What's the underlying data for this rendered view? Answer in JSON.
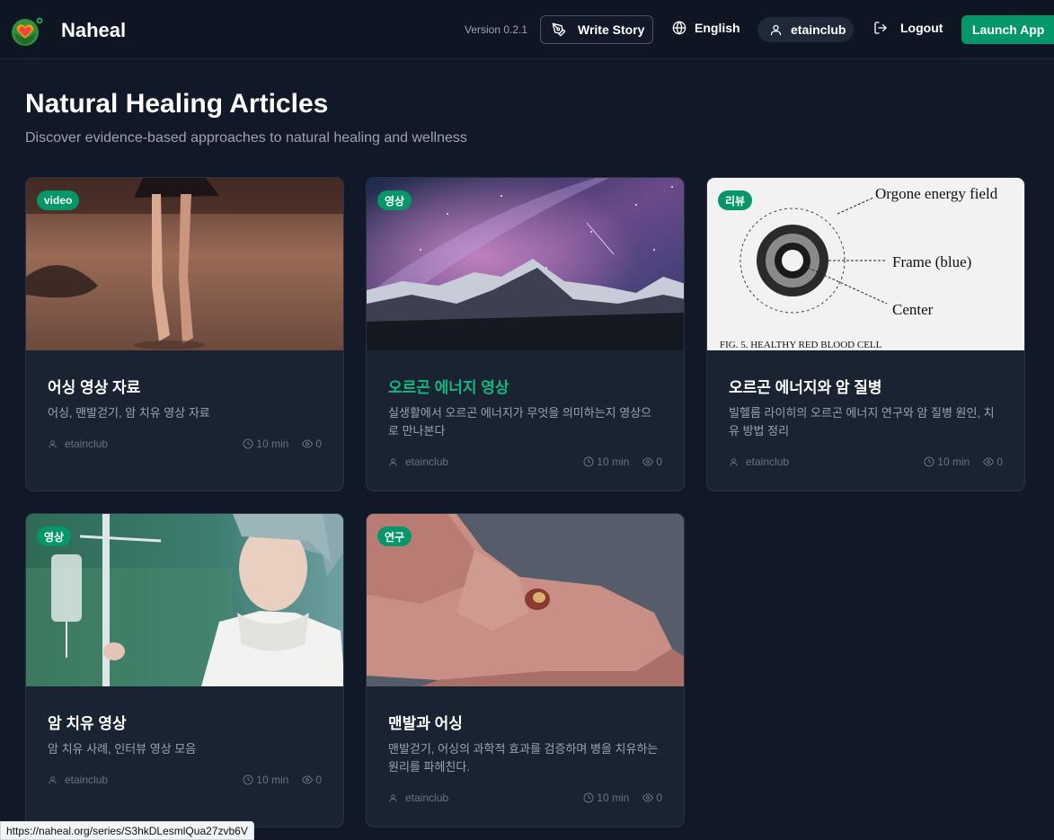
{
  "header": {
    "brand": "Naheal",
    "version": "Version 0.2.1",
    "write_story": "Write Story",
    "language": "English",
    "username": "etainclub",
    "logout": "Logout",
    "launch_app": "Launch App"
  },
  "page": {
    "title": "Natural Healing Articles",
    "subtitle": "Discover evidence-based approaches to natural healing and wellness"
  },
  "articles": [
    {
      "badge": "video",
      "title": "어싱 영상 자료",
      "description": "어싱, 맨발걷기, 암 치유 영상 자료",
      "author": "etainclub",
      "read_time": "10 min",
      "views": "0"
    },
    {
      "badge": "영상",
      "title": "오르곤 에너지 영상",
      "description": "실생활에서 오르곤 에너지가 무엇을 의미하는지 영상으로 만나본다",
      "author": "etainclub",
      "read_time": "10 min",
      "views": "0"
    },
    {
      "badge": "리뷰",
      "title": "오르곤 에너지와 암 질병",
      "description": "빌헬름 라이히의 오르곤 에너지 연구와 암 질병 원인, 치유 방법 정리",
      "author": "etainclub",
      "read_time": "10 min",
      "views": "0",
      "image_labels": {
        "field": "Orgone energy field",
        "frame": "Frame (blue)",
        "center": "Center",
        "caption": "FIG. 5.  HEALTHY RED BLOOD CELL"
      }
    },
    {
      "badge": "영상",
      "title": "암 치유 영상",
      "description": "암 치유 사례, 인터뷰 영상 모음",
      "author": "etainclub",
      "read_time": "10 min",
      "views": "0"
    },
    {
      "badge": "연구",
      "title": "맨발과 어싱",
      "description": "맨발걷기, 어싱의 과학적 효과를 검증하며 병을 치유하는 원리를 파헤친다.",
      "author": "etainclub",
      "read_time": "10 min",
      "views": "0"
    }
  ],
  "status_bar": {
    "url": "https://naheal.org/series/S3hkDLesmlQua27zvb6V"
  },
  "colors": {
    "accent": "#059669",
    "background": "#111827",
    "card": "#1a2332"
  }
}
